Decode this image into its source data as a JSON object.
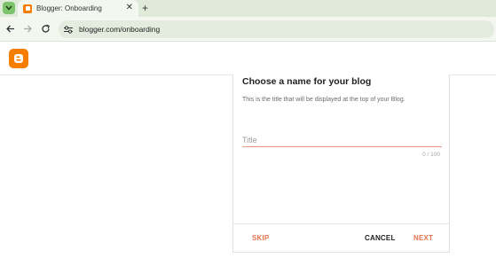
{
  "browser": {
    "tab": {
      "title": "Blogger: Onboarding",
      "close_glyph": "✕"
    },
    "new_tab_glyph": "+",
    "address": {
      "url": "blogger.com/onboarding"
    },
    "icons": [
      "tab-search-icon",
      "back-arrow-icon",
      "forward-arrow-icon",
      "reload-icon",
      "site-settings-icon",
      "close-icon",
      "plus-icon"
    ]
  },
  "header": {
    "logo": "blogger-logo-icon",
    "brand_color": "#f57d00"
  },
  "dialog": {
    "title": "Choose a name for your blog",
    "description": "This is the title that will be displayed at the top of your Blog.",
    "input": {
      "placeholder": "Title",
      "value": ""
    },
    "char_count": "0 / 100",
    "buttons": {
      "skip": "SKIP",
      "cancel": "CANCEL",
      "next": "NEXT"
    },
    "accent_color": "#e2734e"
  }
}
